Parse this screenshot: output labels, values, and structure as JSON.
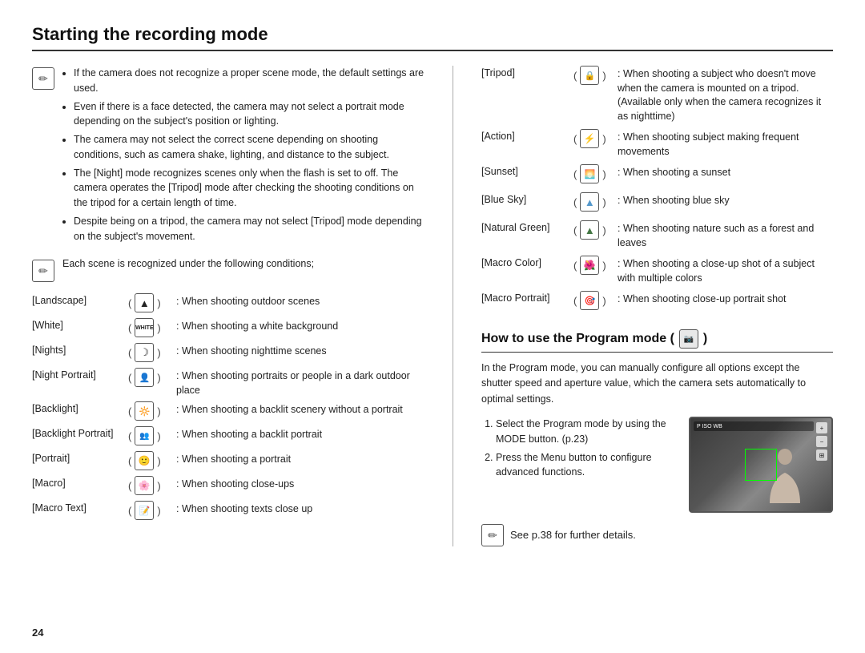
{
  "page": {
    "title": "Starting the recording mode",
    "page_number": "24"
  },
  "left_col": {
    "note1": {
      "bullets": [
        "If the camera does not recognize a proper scene mode, the default settings are used.",
        "Even if there is a face detected, the camera may not select a portrait mode depending on the subject's position or lighting.",
        "The camera may not select the correct scene depending on shooting conditions, such as camera shake, lighting, and distance to the subject.",
        "The [Night] mode recognizes scenes only when the flash is set to off. The camera operates the [Tripod] mode after checking the shooting conditions on the tripod for a certain length of time.",
        "Despite being on a tripod, the camera may not select [Tripod] mode depending on the subject's movement."
      ]
    },
    "note2_intro": "Each scene is recognized under the following conditions;",
    "scenes": [
      {
        "label": "[Landscape]",
        "icon": "▲",
        "desc": "When shooting outdoor scenes"
      },
      {
        "label": "[White]",
        "icon": "W",
        "desc": "When shooting a white background"
      },
      {
        "label": "[Nights]",
        "icon": "☽",
        "desc": "When shooting nighttime scenes"
      },
      {
        "label": "[Night Portrait]",
        "icon": "NP",
        "desc": "When shooting portraits or people in a dark outdoor place"
      },
      {
        "label": "[Backlight]",
        "icon": "BL",
        "desc": "When shooting a backlit scenery without a portrait"
      },
      {
        "label": "[Backlight Portrait]",
        "icon": "BP",
        "desc": "When shooting a backlit portrait"
      },
      {
        "label": "[Portrait]",
        "icon": "👤",
        "desc": "When shooting a portrait"
      },
      {
        "label": "[Macro]",
        "icon": "🌸",
        "desc": "When shooting close-ups"
      },
      {
        "label": "[Macro Text]",
        "icon": "MT",
        "desc": "When shooting texts close up"
      }
    ]
  },
  "right_col": {
    "scenes": [
      {
        "label": "[Tripod]",
        "icon": "🔒",
        "desc": "When shooting a subject who doesn't move when the camera is mounted on a tripod. (Available only when the camera recognizes it as nighttime)"
      },
      {
        "label": "[Action]",
        "icon": "⚡",
        "desc": "When shooting subject making frequent movements"
      },
      {
        "label": "[Sunset]",
        "icon": "▬",
        "desc": "When shooting sunset"
      },
      {
        "label": "[Blue Sky]",
        "icon": "△",
        "desc": "When shooting blue sky"
      },
      {
        "label": "[Natural Green]",
        "icon": "△",
        "desc": "When shooting nature such as a forest and leaves"
      },
      {
        "label": "[Macro Color]",
        "icon": "🌺",
        "desc": "When shooting a close-up shot of a subject with multiple colors"
      },
      {
        "label": "[Macro Portrait]",
        "icon": "🎯",
        "desc": "When shooting close-up portrait shot"
      }
    ],
    "program": {
      "title": "How to use the Program mode (",
      "title_end": " )",
      "description": "In the Program mode, you can manually configure all options except the shutter speed and aperture value, which the camera sets automatically to optimal settings.",
      "steps": [
        "Select the Program mode by using the MODE button. (p.23)",
        "Press the Menu button to configure advanced functions."
      ],
      "see_note": "See p.38 for further details."
    }
  }
}
